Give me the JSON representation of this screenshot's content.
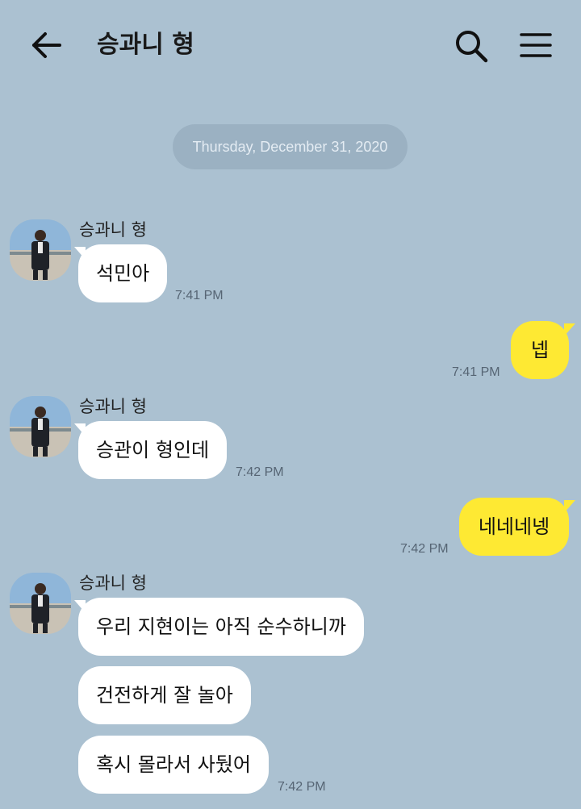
{
  "header": {
    "title": "승과니 형",
    "back_icon": "arrow-left-icon",
    "search_icon": "search-icon",
    "menu_icon": "hamburger-menu-icon"
  },
  "chat": {
    "date": "Thursday, December 31, 2020",
    "sender_name": "승과니 형",
    "messages": [
      {
        "text": "석민아",
        "time": "7:41 PM",
        "from": "them"
      },
      {
        "text": "넵",
        "time": "7:41 PM",
        "from": "me"
      },
      {
        "text": "승관이 형인데",
        "time": "7:42 PM",
        "from": "them"
      },
      {
        "text": "네네네넹",
        "time": "7:42 PM",
        "from": "me"
      },
      {
        "text": "우리 지현이는 아직 순수하니까",
        "from": "them"
      },
      {
        "text": "건전하게 잘 놀아",
        "from": "them"
      },
      {
        "text": "혹시 몰라서 사뒀어",
        "time": "7:42 PM",
        "from": "them"
      }
    ]
  },
  "colors": {
    "background": "#abc1d1",
    "incoming_bubble": "#ffffff",
    "outgoing_bubble": "#fee933",
    "date_pill": "#9bb1c2"
  }
}
